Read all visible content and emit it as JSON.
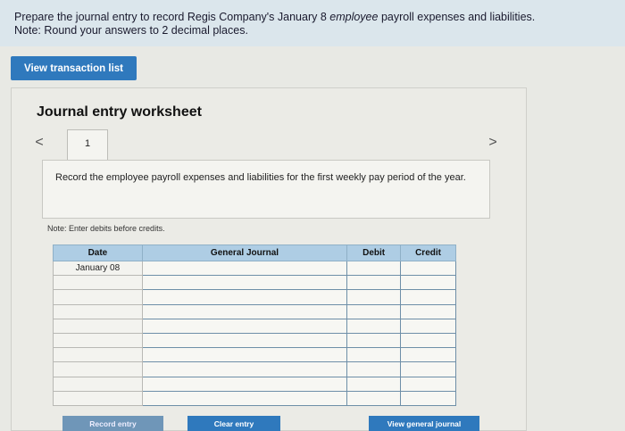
{
  "instructions": {
    "line1_prefix": "Prepare the journal entry to record Regis Company's January 8 ",
    "line1_emphasis": "employee",
    "line1_suffix": " payroll expenses and liabilities.",
    "line2": "Note: Round your answers to 2 decimal places."
  },
  "view_transaction_list_label": "View transaction list",
  "worksheet": {
    "title": "Journal entry worksheet",
    "prev_arrow": "<",
    "next_arrow": ">",
    "current_tab": "1",
    "description": "Record the employee payroll expenses and liabilities for the first weekly pay period of the year.",
    "note": "Note: Enter debits before credits.",
    "table": {
      "headers": [
        "Date",
        "General Journal",
        "Debit",
        "Credit"
      ],
      "date_value": "January 08",
      "row_count": 10
    },
    "buttons": {
      "record": "Record entry",
      "clear": "Clear entry",
      "general_journal": "View general journal"
    }
  },
  "colors": {
    "button_blue": "#2f79bd",
    "header_blue": "#aecde4",
    "instructions_bg": "#dbe6ec"
  }
}
